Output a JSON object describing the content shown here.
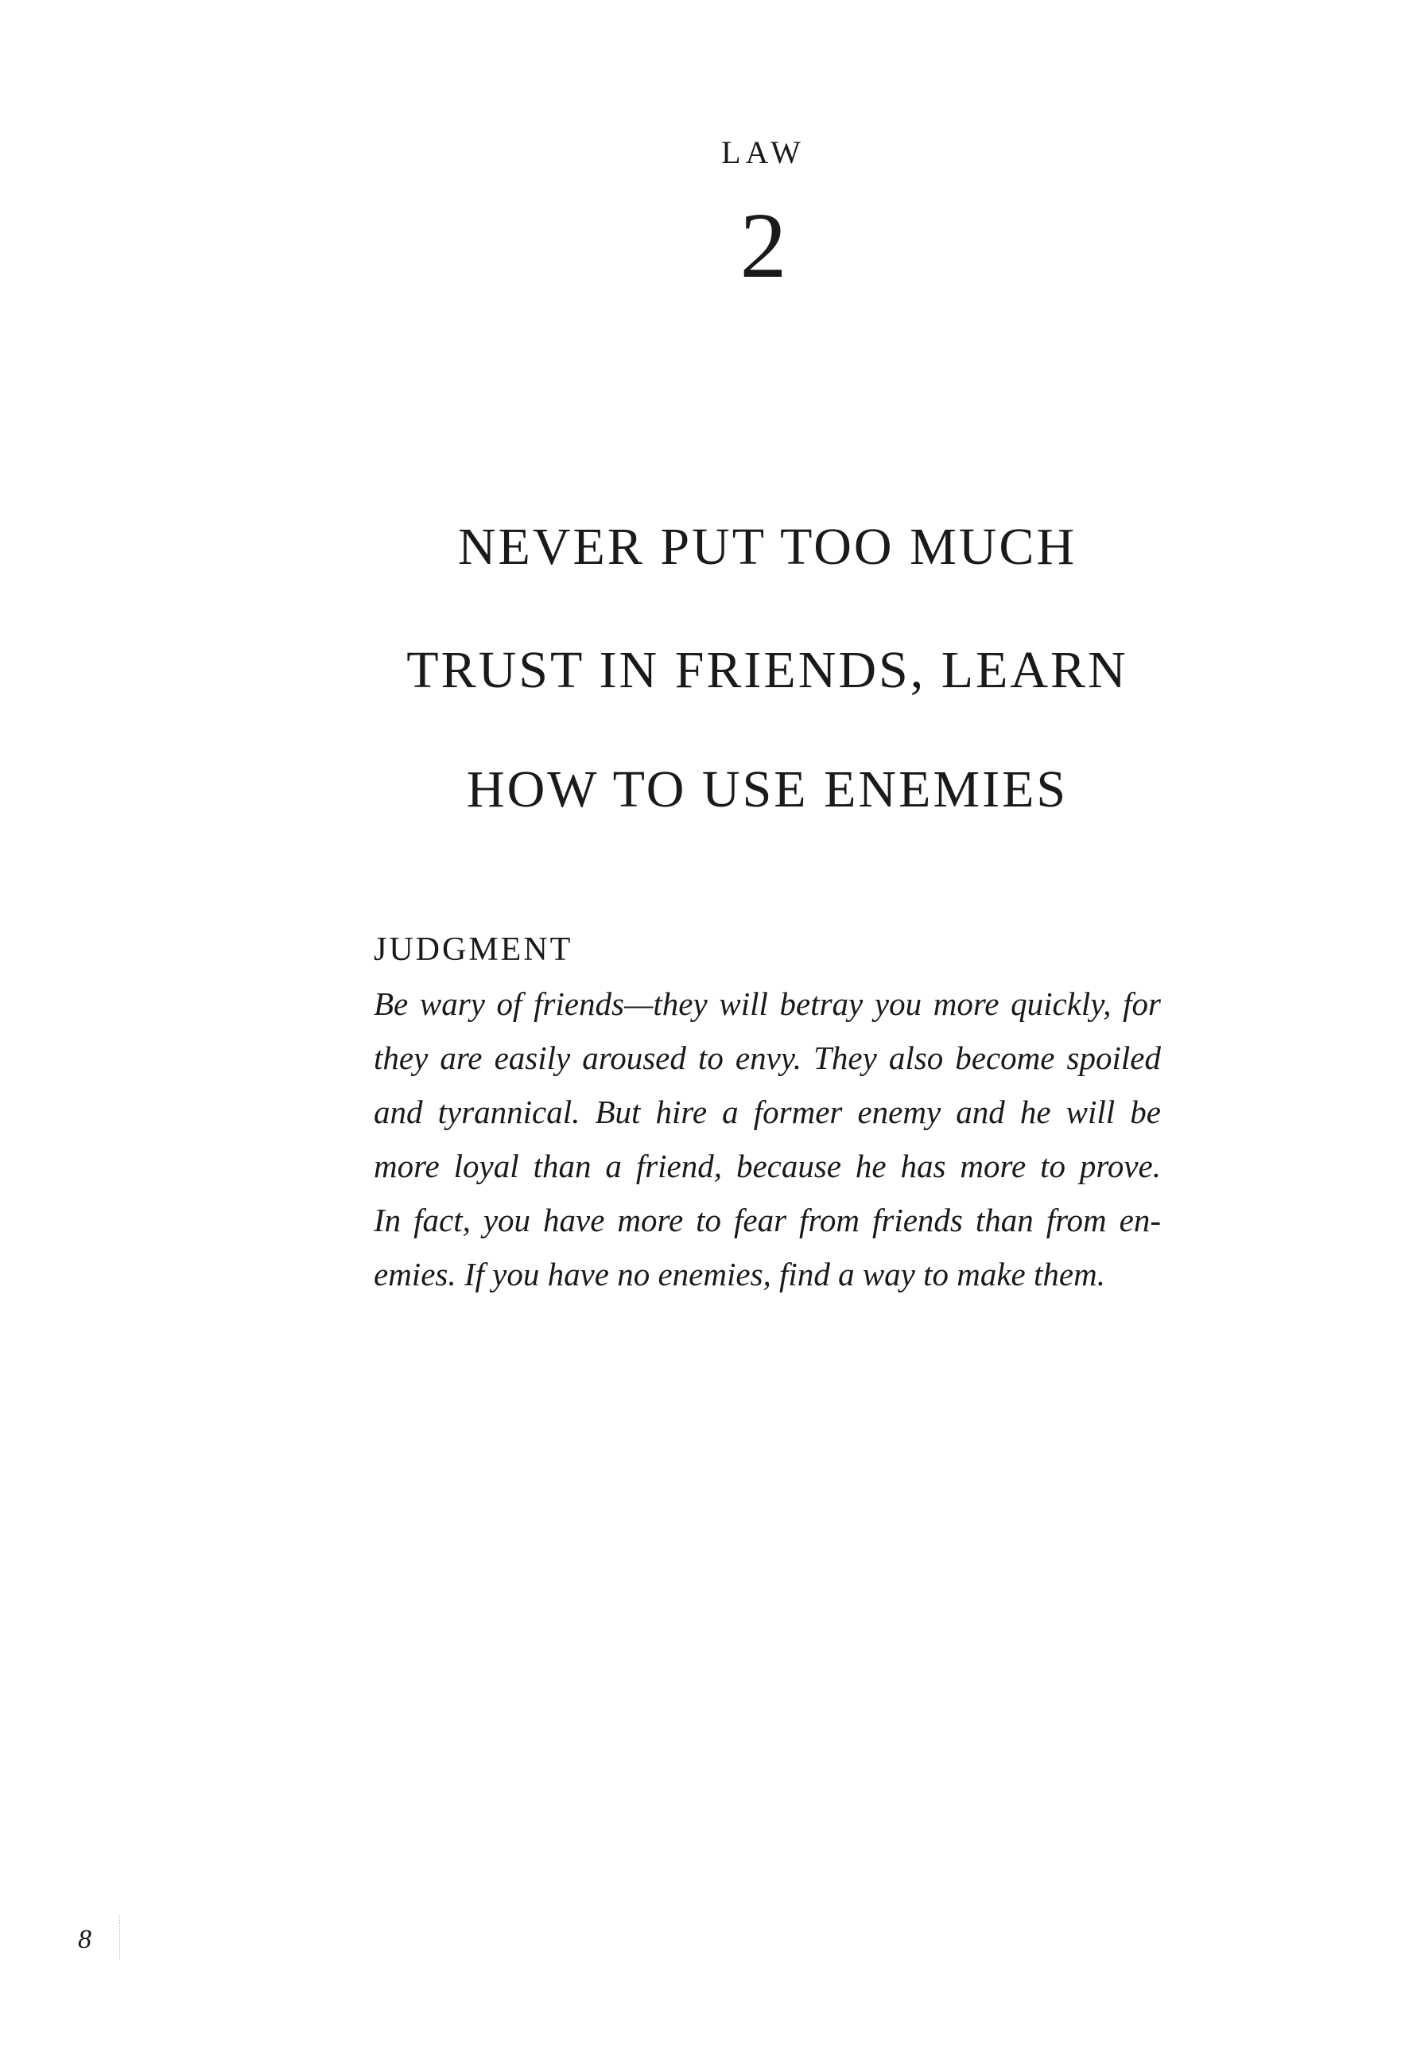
{
  "header": {
    "label": "LAW",
    "number": "2"
  },
  "title": {
    "lines": [
      "NEVER PUT TOO MUCH",
      "TRUST IN FRIENDS, LEARN",
      "HOW TO USE ENEMIES"
    ]
  },
  "judgment": {
    "heading": "JUDGMENT",
    "lines": [
      "Be wary of friends—they will betray you more quickly, for",
      "they are easily aroused to envy. They also become spoiled",
      "and tyrannical. But hire a former enemy and he will be",
      "more loyal than a friend, because he has more to prove.",
      "In fact, you have more to fear from friends than from en-",
      "emies. If you have no enemies, find a way to make them."
    ]
  },
  "footer": {
    "page_number": "8"
  }
}
